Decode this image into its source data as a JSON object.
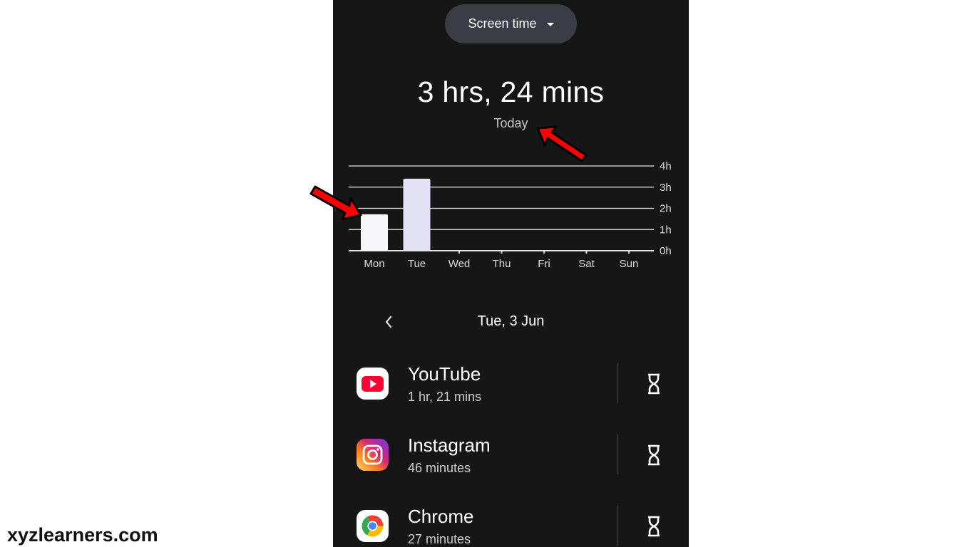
{
  "header": {
    "dropdown_label": "Screen time"
  },
  "summary": {
    "total": "3 hrs, 24 mins",
    "period": "Today"
  },
  "chart_data": {
    "type": "bar",
    "categories": [
      "Mon",
      "Tue",
      "Wed",
      "Thu",
      "Fri",
      "Sat",
      "Sun"
    ],
    "values": [
      1.72,
      3.4,
      0,
      0,
      0,
      0,
      0
    ],
    "ylim": [
      0,
      4
    ],
    "y_ticks": [
      "0h",
      "1h",
      "2h",
      "3h",
      "4h"
    ],
    "grid": true,
    "colors": {
      "selected": "#e3e1f5",
      "other": "#f7f7fb",
      "grid": "#e6e6e6"
    },
    "selected_index": 1
  },
  "date_nav": {
    "label": "Tue, 3 Jun"
  },
  "apps": [
    {
      "name": "YouTube",
      "time": "1 hr, 21 mins",
      "icon": "youtube-icon"
    },
    {
      "name": "Instagram",
      "time": "46 minutes",
      "icon": "instagram-icon"
    },
    {
      "name": "Chrome",
      "time": "27 minutes",
      "icon": "chrome-icon"
    }
  ],
  "watermark": "xyzlearners.com",
  "colors": {
    "background": "#161616",
    "dropdown": "#3b3d46",
    "annotation_arrow": "#ff0000"
  }
}
